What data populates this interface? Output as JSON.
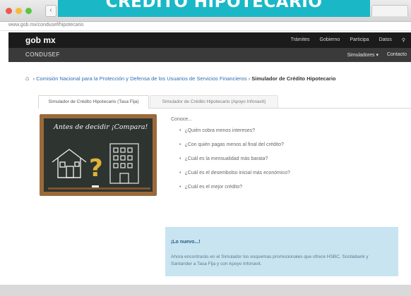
{
  "banner_title": "CRÉDITO HIPOTECARIO",
  "browser": {
    "url": "www.gob.mx/condusef/hipotecario"
  },
  "gob_header": {
    "logo": "gob mx",
    "menu": [
      "Trámites",
      "Gobierno",
      "Participa",
      "Datos"
    ]
  },
  "condusef_bar": {
    "title": "CONDUSEF",
    "menu": [
      "Simuladores ▾",
      "Contacto"
    ]
  },
  "breadcrumb": {
    "link": "Comisión Nacional para la Protección y Defensa de los Usuarios de Servicios Financieros",
    "separator": "›",
    "current": "Simulador de Crédito Hipotecario"
  },
  "tabs": [
    {
      "label": "Simulador de Crédito Hipotecario (Tasa Fija)",
      "active": true
    },
    {
      "label": "Simulador de Crédito Hipotecario (Apoyo Infonavit)",
      "active": false
    }
  ],
  "chalkboard": {
    "title": "Antes de decidir ¡Compara!"
  },
  "content": {
    "intro": "Conoce...",
    "questions": [
      "¿Quién cobra menos intereses?",
      "¿Con quién pagas menos al final del crédito?",
      "¿Cuál es la mensualidad más barata?",
      "¿Cuál es el desembolso inicial más económico?",
      "¿Cuál es el mejor crédito?"
    ]
  },
  "info_box": {
    "title": "¡Lo nuevo...!",
    "text": "Ahora encontrarás en el Simulador los esquemas promocionales que ofrece HSBC, Scotiabank y Santander a Tasa Fija y con Apoyo Infonavit."
  },
  "colors": {
    "banner": "#1ab8c7",
    "gob_bar": "#1b1b1b",
    "condusef_bar": "#3a3a3a",
    "link": "#2c6fb1",
    "info_box": "#c8e4f1"
  }
}
